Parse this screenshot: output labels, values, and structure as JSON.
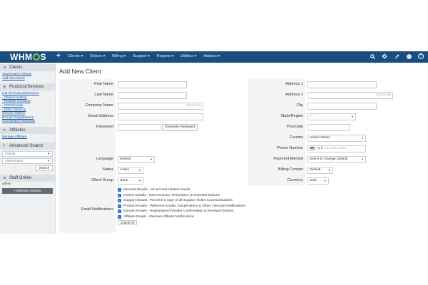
{
  "topbar": {
    "logo": "WHMCS",
    "logo_before": "WHM",
    "logo_after": "S",
    "plus": "+",
    "nav": [
      "Clients ▾",
      "Orders ▾",
      "Billing ▾",
      "Support ▾",
      "Reports ▾",
      "Utilities ▾",
      "Addons ▾"
    ],
    "icons": [
      "search-icon",
      "gear-icon",
      "wrench-icon",
      "avatar-icon",
      "help-icon"
    ],
    "help_glyph": "?"
  },
  "sidebar": {
    "clients_head": "Clients",
    "clients_links": [
      "View/Search Clients",
      "Add New Client"
    ],
    "products_head": "Products/Services",
    "products_links": [
      "List All Products/Services",
      "- Shared Hosting",
      "- Reseller Accounts",
      "- VPS/Servers",
      "- Other Services",
      "Service Addons",
      "Domain Registrations",
      "Cancellation Requests"
    ],
    "affiliates_head": "Affiliates",
    "affiliates_links": [
      "Manage Affiliates"
    ],
    "search_head": "Advanced Search",
    "search_type": "Clients",
    "search_field": "Client Name",
    "search_button": "Search",
    "staff_head": "Staff Online",
    "staff_user": "admin",
    "minimise": "« Minimise Sidebar"
  },
  "main": {
    "title": "Add New Client",
    "labels": {
      "first_name": "First Name",
      "last_name": "Last Name",
      "company": "Company Name",
      "email": "Email Address",
      "password": "Password",
      "address1": "Address 1",
      "address2": "Address 2",
      "city": "City",
      "state": "State/Region",
      "postcode": "Postcode",
      "country": "Country",
      "phone": "Phone Number",
      "language": "Language",
      "status": "Status",
      "client_group": "Client Group",
      "payment_method": "Payment Method",
      "billing_contact": "Billing Contact",
      "currency": "Currency",
      "email_notifications": "Email Notifications"
    },
    "placeholders": {
      "company": "(Optional)",
      "address2": "(Optional)",
      "phone": "201-555-0123"
    },
    "values": {
      "state": "—",
      "country": "United States",
      "phone_code": "+1 ▾",
      "language": "Default",
      "status": "Active",
      "client_group": "None",
      "payment_method": "Select to Change Default",
      "billing_contact": "Default",
      "currency": "USD"
    },
    "generate_password": "Generate Password",
    "notifications": [
      "General Emails - All account related emails",
      "Invoice Emails - New Invoices, Reminders, & Overdue Notices",
      "Support Emails - Receive a copy of all Support Ticket Communications",
      "Product Emails - Welcome Emails, Suspensions & Other Lifecycle Notifications",
      "Domain Emails - Registration/Transfer Confirmation & Renewal Notices",
      "Affiliate Emails - Receive Affiliate Notifications"
    ],
    "check_all": "Check All"
  },
  "colors": {
    "topbar": "#1a4d80",
    "logo_ring": "#8bc34a",
    "checkbox": "#1f6fc6",
    "link": "#1a5aa6"
  }
}
